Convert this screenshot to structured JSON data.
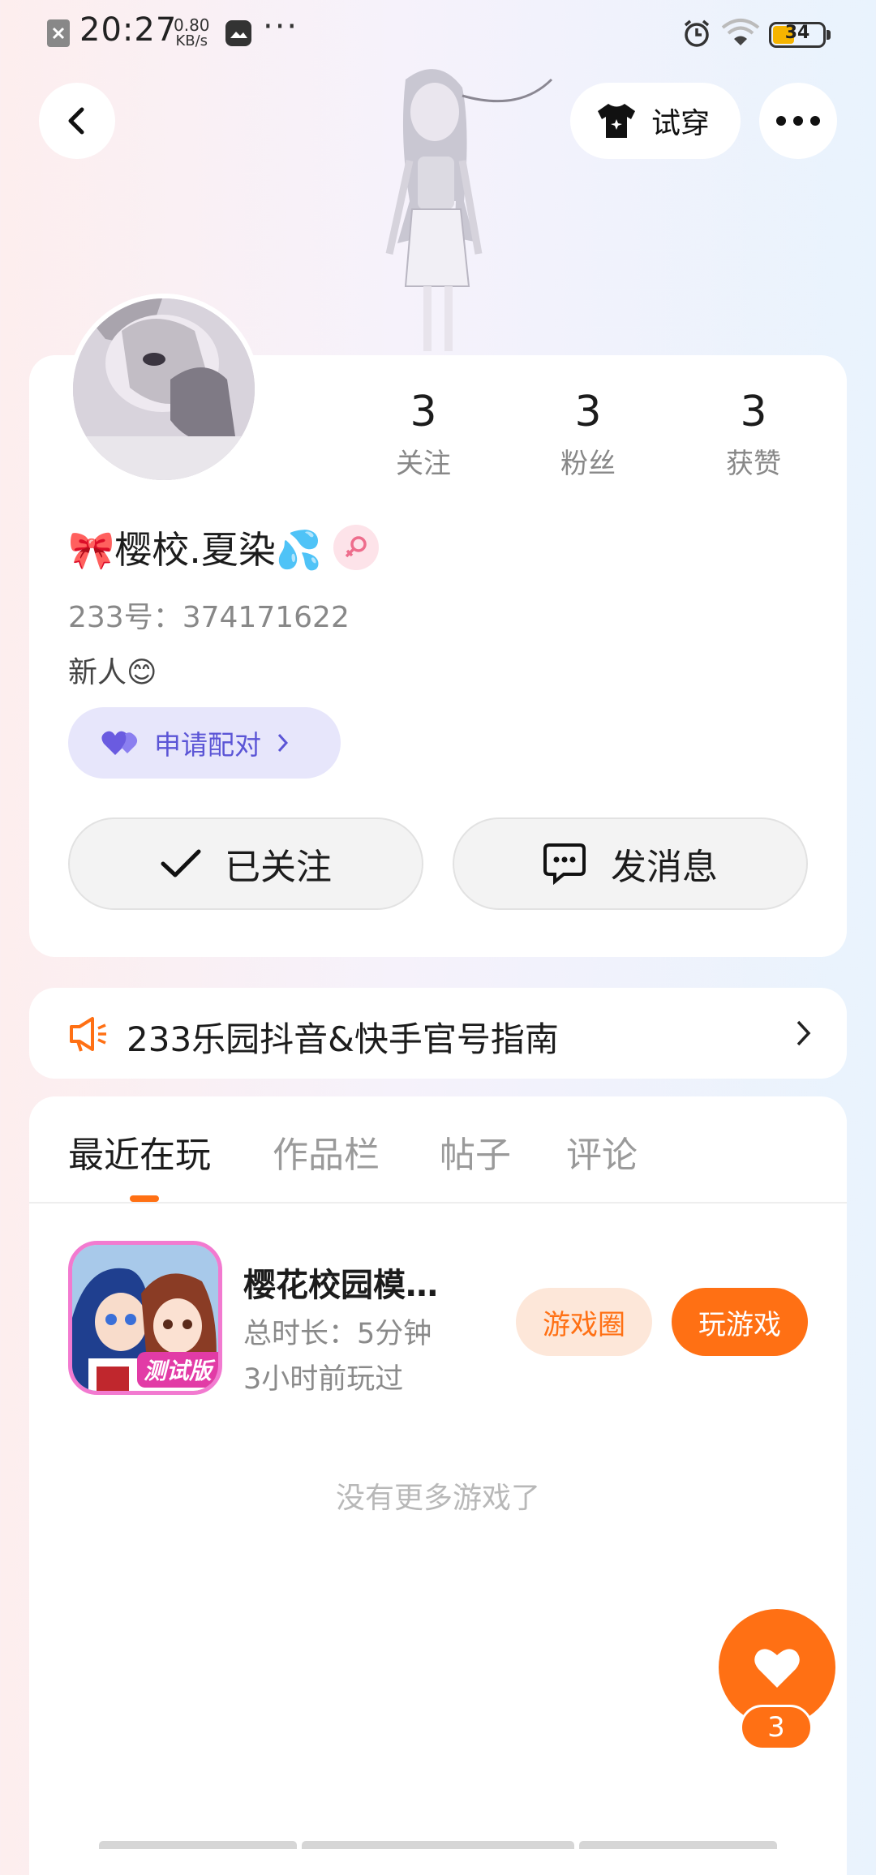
{
  "status_bar": {
    "time": "20:27",
    "speed_value": "0.80",
    "speed_unit": "KB/s",
    "more": "···",
    "battery": "34"
  },
  "header": {
    "try_on_label": "试穿"
  },
  "profile": {
    "stats": [
      {
        "value": "3",
        "label": "关注"
      },
      {
        "value": "3",
        "label": "粉丝"
      },
      {
        "value": "3",
        "label": "获赞"
      }
    ],
    "name": "🎀樱校.夏染💦",
    "id_text": "233号：374171622",
    "bio": "新人😊",
    "match_label": "申请配对",
    "followed_label": "已关注",
    "message_label": "发消息"
  },
  "notice": {
    "text": "233乐园抖音&快手官号指南"
  },
  "tabs": {
    "items": [
      "最近在玩",
      "作品栏",
      "帖子",
      "评论"
    ],
    "active_index": 0
  },
  "game": {
    "title": "樱花校园模…",
    "duration": "总时长：5分钟",
    "last_played": "3小时前玩过",
    "badge": "测试版",
    "circle_btn": "游戏圈",
    "play_btn": "玩游戏"
  },
  "empty_text": "没有更多游戏了",
  "like_fab": {
    "count": "3"
  },
  "colors": {
    "accent": "#ff7014",
    "accent_light": "#fde7d9",
    "match_bg": "#e7e6fb",
    "match_fg": "#5b55d6"
  }
}
